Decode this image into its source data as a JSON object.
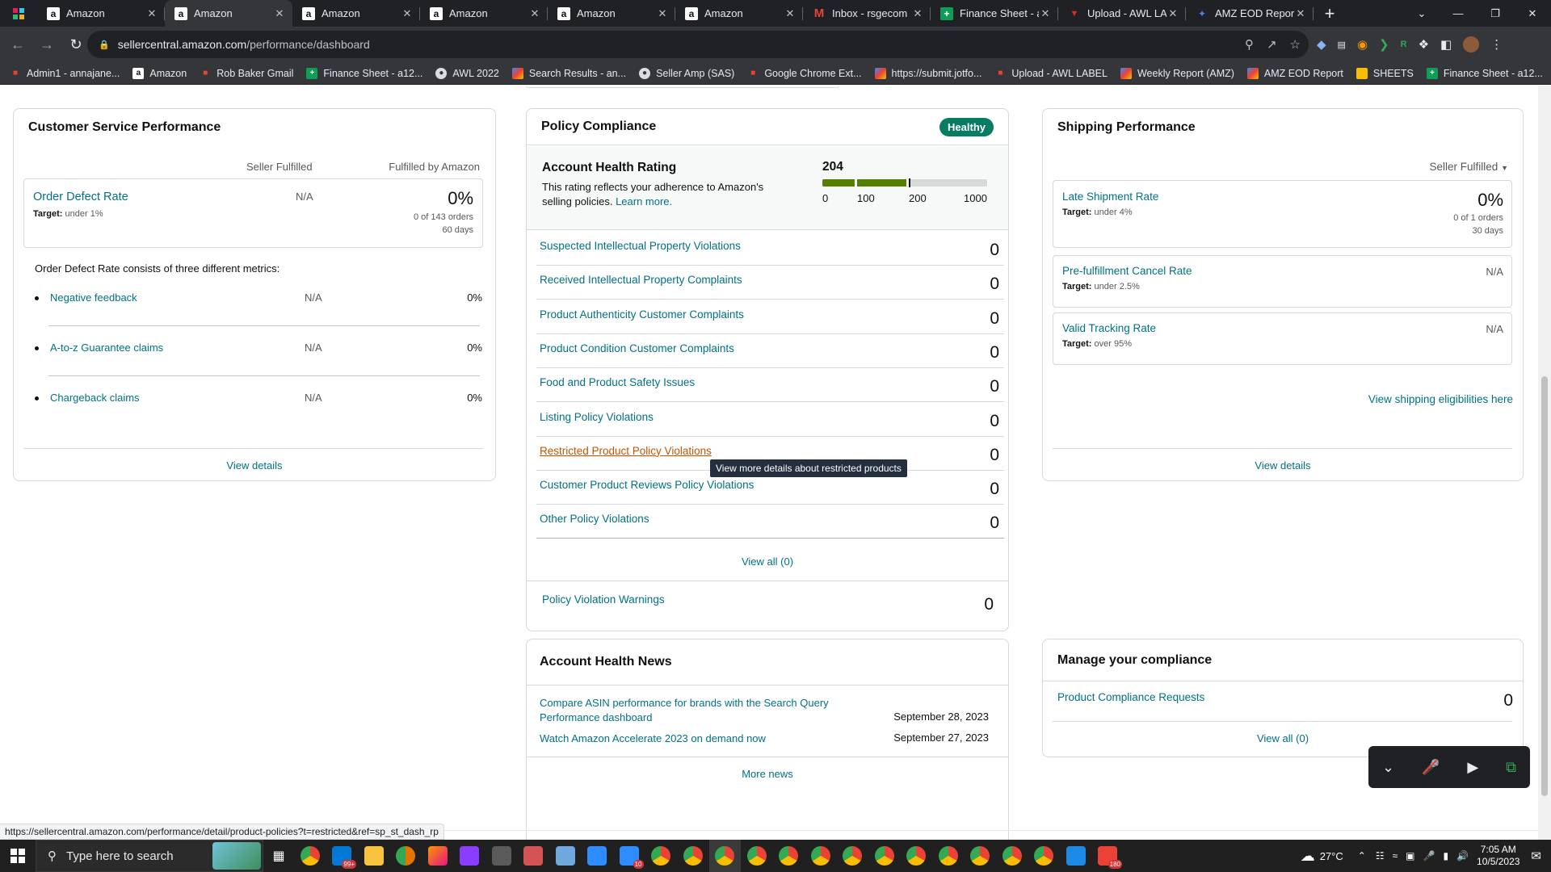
{
  "browser": {
    "tabs": [
      {
        "title": "Amazon",
        "favicon": "amazon-icon",
        "active": false
      },
      {
        "title": "Amazon",
        "favicon": "amazon-icon",
        "active": true
      },
      {
        "title": "Amazon",
        "favicon": "amazon-icon",
        "active": false
      },
      {
        "title": "Amazon",
        "favicon": "amazon-icon",
        "active": false
      },
      {
        "title": "Amazon",
        "favicon": "amazon-icon",
        "active": false
      },
      {
        "title": "Amazon",
        "favicon": "amazon-icon",
        "active": false
      },
      {
        "title": "Inbox - rsgecom",
        "favicon": "gmail-icon",
        "active": false
      },
      {
        "title": "Finance Sheet - a",
        "favicon": "sheets-icon",
        "active": false
      },
      {
        "title": "Upload - AWL LA",
        "favicon": "awl-icon",
        "active": false
      },
      {
        "title": "AMZ EOD Repor",
        "favicon": "eod-icon",
        "active": false
      }
    ],
    "url_host": "sellercentral.amazon.com",
    "url_path": "/performance/dashboard",
    "bookmarks": [
      {
        "label": "Admin1 - annajane...",
        "icon": "red"
      },
      {
        "label": "Amazon",
        "icon": "amz"
      },
      {
        "label": "Rob Baker Gmail",
        "icon": "red"
      },
      {
        "label": "Finance Sheet - a12...",
        "icon": "green"
      },
      {
        "label": "AWL 2022",
        "icon": "gray"
      },
      {
        "label": "Search Results - an...",
        "icon": "multi"
      },
      {
        "label": "Seller Amp (SAS)",
        "icon": "gray"
      },
      {
        "label": "Google Chrome Ext...",
        "icon": "red"
      },
      {
        "label": "https://submit.jotfo...",
        "icon": "multi"
      },
      {
        "label": "Upload - AWL LABEL",
        "icon": "red"
      },
      {
        "label": "Weekly Report (AMZ)",
        "icon": "multi"
      },
      {
        "label": "AMZ EOD Report",
        "icon": "multi"
      },
      {
        "label": "SHEETS",
        "icon": "yellow"
      },
      {
        "label": "Finance Sheet - a12...",
        "icon": "green"
      }
    ]
  },
  "customer_service": {
    "title": "Customer Service Performance",
    "col_seller": "Seller Fulfilled",
    "col_fba": "Fulfilled by Amazon",
    "odr_label": "Order Defect Rate",
    "odr_target_prefix": "Target:",
    "odr_target": "under 1%",
    "odr_seller": "N/A",
    "odr_fba": "0%",
    "odr_orders": "0 of 143 orders",
    "odr_days": "60 days",
    "consists_text": "Order Defect Rate consists of three different metrics:",
    "metrics": [
      {
        "label": "Negative feedback",
        "seller": "N/A",
        "fba": "0%"
      },
      {
        "label": "A-to-z Guarantee claims",
        "seller": "N/A",
        "fba": "0%"
      },
      {
        "label": "Chargeback claims",
        "seller": "N/A",
        "fba": "0%"
      }
    ],
    "view_details": "View details"
  },
  "policy": {
    "title": "Policy Compliance",
    "badge": "Healthy",
    "ahr_title": "Account Health Rating",
    "ahr_score": "204",
    "ahr_desc": "This rating reflects your adherence to Amazon's selling policies.",
    "ahr_learn": "Learn more.",
    "scale": [
      "0",
      "100",
      "200",
      "1000"
    ],
    "rating_value": 204,
    "rows": [
      {
        "label": "Suspected Intellectual Property Violations",
        "value": "0"
      },
      {
        "label": "Received Intellectual Property Complaints",
        "value": "0"
      },
      {
        "label": "Product Authenticity Customer Complaints",
        "value": "0"
      },
      {
        "label": "Product Condition Customer Complaints",
        "value": "0"
      },
      {
        "label": "Food and Product Safety Issues",
        "value": "0"
      },
      {
        "label": "Listing Policy Violations",
        "value": "0"
      },
      {
        "label": "Restricted Product Policy Violations",
        "value": "0"
      },
      {
        "label": "Customer Product Reviews Policy Violations",
        "value": "0"
      },
      {
        "label": "Other Policy Violations",
        "value": "0"
      }
    ],
    "view_all": "View all (0)",
    "warnings_label": "Policy Violation Warnings",
    "warnings_value": "0",
    "tooltip": "View more details about restricted products"
  },
  "news": {
    "title": "Account Health News",
    "items": [
      {
        "title": "Compare ASIN performance for brands with the Search Query Performance dashboard",
        "date": "September 28, 2023"
      },
      {
        "title": "Watch Amazon Accelerate 2023 on demand now",
        "date": "September 27, 2023"
      }
    ],
    "more": "More news"
  },
  "shipping": {
    "title": "Shipping Performance",
    "filter": "Seller Fulfilled",
    "late_label": "Late Shipment Rate",
    "late_target_prefix": "Target:",
    "late_target": "under 4%",
    "late_value": "0%",
    "late_orders": "0 of 1 orders",
    "late_days": "30 days",
    "cancel_label": "Pre-fulfillment Cancel Rate",
    "cancel_target_prefix": "Target:",
    "cancel_target": "under 2.5%",
    "cancel_value": "N/A",
    "tracking_label": "Valid Tracking Rate",
    "tracking_target_prefix": "Target:",
    "tracking_target": "over 95%",
    "tracking_value": "N/A",
    "eligibilities": "View shipping eligibilities here",
    "view_details": "View details"
  },
  "compliance": {
    "title": "Manage your compliance",
    "requests_label": "Product Compliance Requests",
    "requests_value": "0",
    "view_all": "View all (0)"
  },
  "status_url": "https://sellercentral.amazon.com/performance/detail/product-policies?t=restricted&ref=sp_st_dash_rp",
  "taskbar": {
    "search_placeholder": "Type here to search",
    "mail_badge": "99+",
    "zoom_badge": "10",
    "weather": "27°C",
    "time": "7:05 AM",
    "date": "10/5/2023",
    "notif_badge": "180"
  }
}
